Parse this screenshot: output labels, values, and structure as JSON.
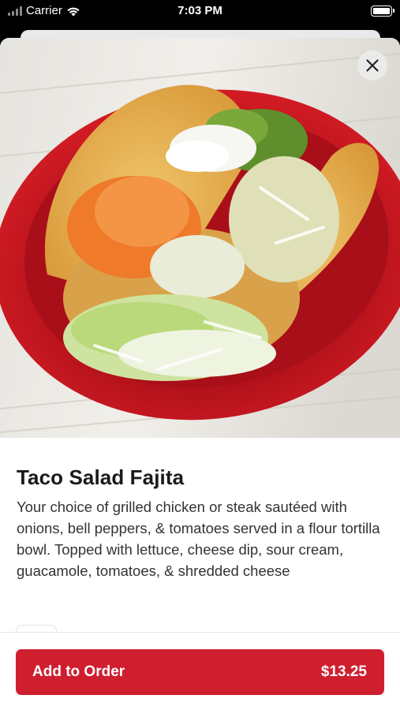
{
  "status_bar": {
    "carrier": "Carrier",
    "time": "7:03 PM"
  },
  "item": {
    "title": "Taco Salad Fajita",
    "description": "Your choice of grilled chicken or steak sautéed with onions, bell peppers, & tomatoes served in a flour tortilla bowl. Topped with lettuce, cheese dip, sour cream, guacamole, tomatoes, & shredded cheese",
    "image_subject": "taco salad in fried tortilla shell on a red plate"
  },
  "actions": {
    "close_icon": "close-icon",
    "add_to_order_label": "Add to Order",
    "price": "$13.25"
  },
  "colors": {
    "accent": "#cf1f2f",
    "plate": "#c8161f"
  }
}
